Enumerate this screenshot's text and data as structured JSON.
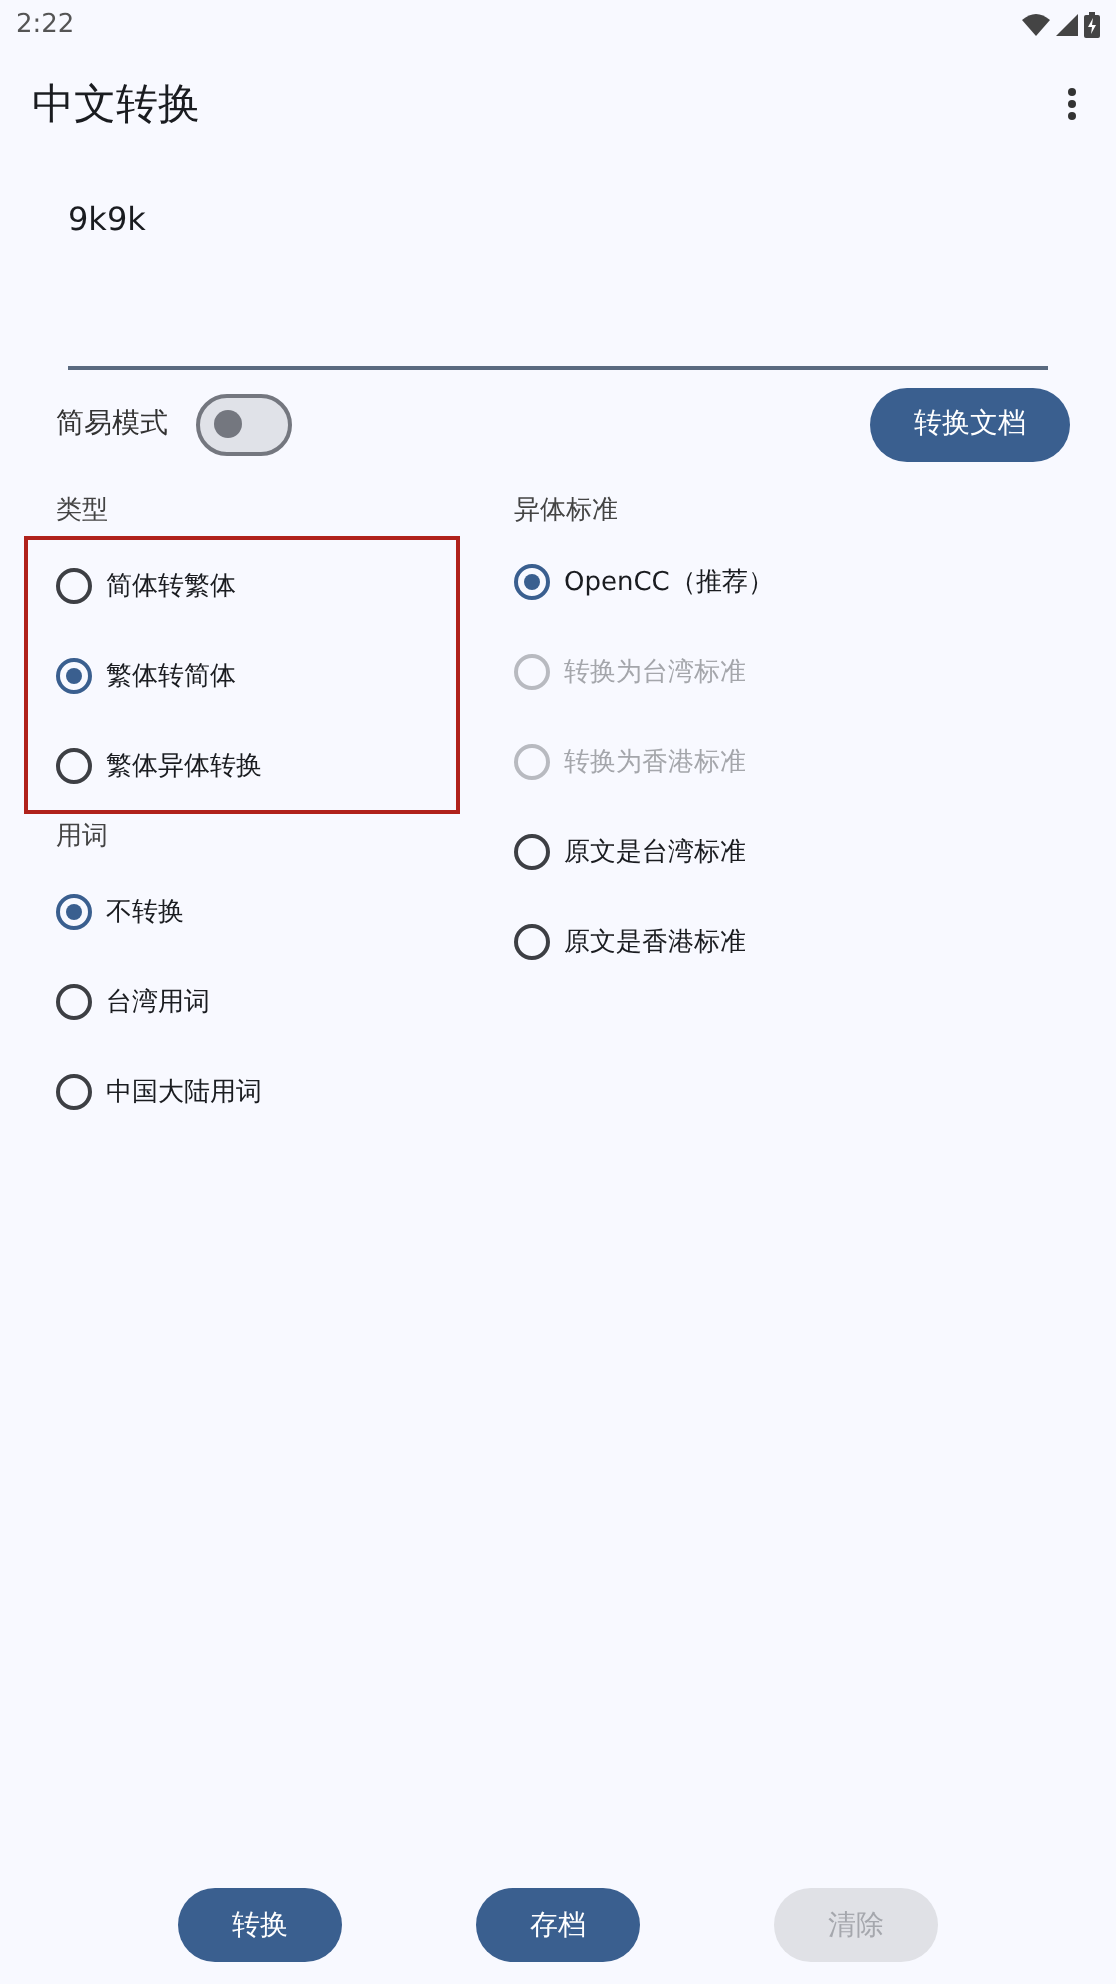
{
  "status_bar": {
    "time": "2:22"
  },
  "app_bar": {
    "title": "中文转换"
  },
  "input": {
    "value": "9k9k"
  },
  "simple_mode": {
    "label": "简易模式",
    "on": false
  },
  "convert_document_button": "转换文档",
  "left_column": [
    {
      "title": "类型",
      "highlighted": true,
      "options": [
        {
          "label": "简体转繁体",
          "selected": false,
          "disabled": false
        },
        {
          "label": "繁体转简体",
          "selected": true,
          "disabled": false
        },
        {
          "label": "繁体异体转换",
          "selected": false,
          "disabled": false
        }
      ]
    },
    {
      "title": "用词",
      "highlighted": false,
      "options": [
        {
          "label": "不转换",
          "selected": true,
          "disabled": false
        },
        {
          "label": "台湾用词",
          "selected": false,
          "disabled": false
        },
        {
          "label": "中国大陆用词",
          "selected": false,
          "disabled": false
        }
      ]
    }
  ],
  "right_column": [
    {
      "title": "异体标准",
      "highlighted": false,
      "options": [
        {
          "label": "OpenCC（推荐）",
          "selected": true,
          "disabled": false
        },
        {
          "label": "转换为台湾标准",
          "selected": false,
          "disabled": true
        },
        {
          "label": "转换为香港标准",
          "selected": false,
          "disabled": true
        },
        {
          "label": "原文是台湾标准",
          "selected": false,
          "disabled": false
        },
        {
          "label": "原文是香港标准",
          "selected": false,
          "disabled": false
        }
      ]
    }
  ],
  "bottom_buttons": [
    {
      "label": "转换",
      "disabled": false
    },
    {
      "label": "存档",
      "disabled": false
    },
    {
      "label": "清除",
      "disabled": true
    }
  ]
}
